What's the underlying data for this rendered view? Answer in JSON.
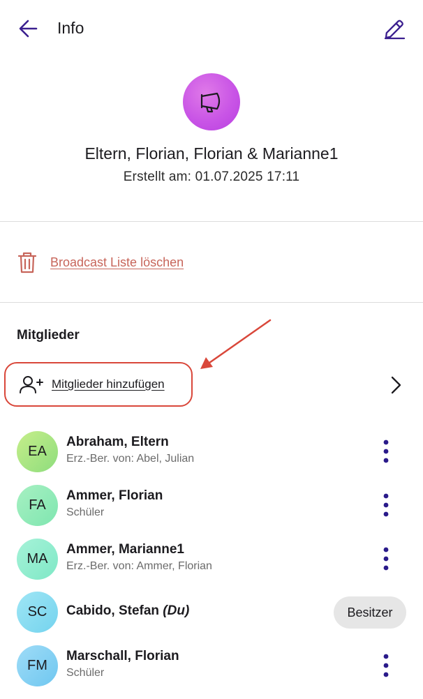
{
  "header": {
    "title": "Info",
    "back_icon": "arrow-left-icon",
    "edit_icon": "pencil-icon",
    "accent_color": "#3b1f8f"
  },
  "group": {
    "avatar_icon": "megaphone-icon",
    "name": "Eltern, Florian, Florian & Marianne1",
    "created": "Erstellt am: 01.07.2025 17:11"
  },
  "delete_action": {
    "icon": "trash-icon",
    "label": "Broadcast Liste löschen",
    "color": "#c7655a"
  },
  "members_section": {
    "title": "Mitglieder",
    "add_label": "Mitglieder hinzufügen",
    "add_icon": "add-user-icon",
    "highlight_color": "#d9473a"
  },
  "members": [
    {
      "initials": "EA",
      "name": "Abraham, Eltern",
      "suffix": "",
      "subtitle": "Erz.-Ber. von: Abel, Julian",
      "color_from": "#c6ee8a",
      "color_to": "#8edd7d"
    },
    {
      "initials": "FA",
      "name": "Ammer, Florian",
      "suffix": "",
      "subtitle": "Schüler",
      "color_from": "#a7f0c2",
      "color_to": "#7fe6b0"
    },
    {
      "initials": "MA",
      "name": "Ammer, Marianne1",
      "suffix": "",
      "subtitle": "Erz.-Ber. von: Ammer, Florian",
      "color_from": "#a6f2d8",
      "color_to": "#7fe8c6"
    },
    {
      "initials": "SC",
      "name": "Cabido, Stefan",
      "suffix": "(Du)",
      "subtitle": "",
      "badge": "Besitzer",
      "color_from": "#9fe6f5",
      "color_to": "#74d3ee"
    },
    {
      "initials": "FM",
      "name": "Marschall, Florian",
      "suffix": "",
      "subtitle": "Schüler",
      "color_from": "#9fdcf7",
      "color_to": "#6fc7f0"
    }
  ]
}
